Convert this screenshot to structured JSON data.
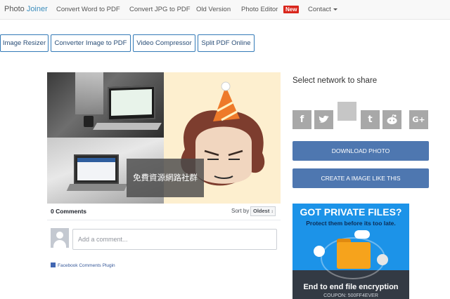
{
  "navbar": {
    "brand_prefix": "Photo ",
    "brand_accent": "Joiner",
    "links": [
      "Convert Word to PDF",
      "Convert JPG to PDF",
      "Old Version",
      "Photo Editor"
    ],
    "new_badge": "New",
    "contact": "Contact"
  },
  "tools": {
    "buttons": [
      "Image Resizer",
      "Converter Image to PDF",
      "Video Compressor",
      "Split PDF Online"
    ]
  },
  "photo": {
    "caption": "免費資源網路社群"
  },
  "comments": {
    "count_label": "0 Comments",
    "sort_by_label": "Sort by",
    "sort_value": "Oldest",
    "input_placeholder": "Add a comment...",
    "plugin_label": "Facebook Comments Plugin"
  },
  "share": {
    "title": "Select network to share",
    "icons": [
      "facebook-icon",
      "twitter-icon",
      "blank",
      "tumblr-icon",
      "reddit-icon",
      "google-plus-icon"
    ],
    "download_label": "DOWNLOAD PHOTO",
    "create_label": "CREATE A IMAGE LIKE THIS"
  },
  "ad": {
    "headline": "GOT PRIVATE FILES?",
    "subline": "Protect them before its too late.",
    "tagline": "End to end file encryption",
    "coupon": "COUPON: 500FF4EVER"
  },
  "colors": {
    "accent": "#3c8dbc",
    "new_badge": "#d9261c",
    "action_button": "#4e77b0",
    "share_icon": "#a8a8a8",
    "ad_background": "#1c93e8"
  }
}
